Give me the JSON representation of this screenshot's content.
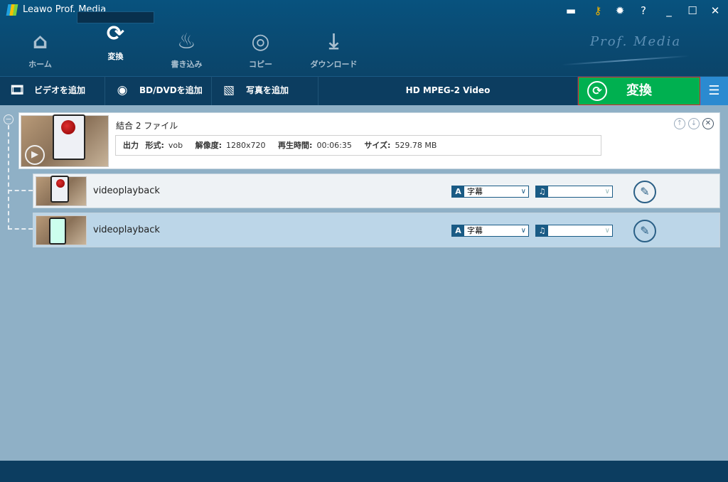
{
  "app": {
    "title": "Leawo Prof. Media",
    "watermark": "Prof. Media"
  },
  "nav": [
    {
      "label": "ホーム",
      "icon": "home-icon"
    },
    {
      "label": "変換",
      "icon": "convert-icon"
    },
    {
      "label": "書き込み",
      "icon": "burn-icon"
    },
    {
      "label": "コピー",
      "icon": "copy-icon"
    },
    {
      "label": "ダウンロード",
      "icon": "download-icon"
    }
  ],
  "toolbar": {
    "add_video": "ビデオを追加",
    "add_disc": "BD/DVDを追加",
    "add_photo": "写真を追加",
    "profile": "HD MPEG-2 Video",
    "convert": "変換"
  },
  "merged": {
    "title": "結合 2 ファイル",
    "output_label": "出力",
    "format_label": "形式:",
    "format": "vob",
    "resolution_label": "解像度:",
    "resolution": "1280x720",
    "duration_label": "再生時間:",
    "duration": "00:06:35",
    "size_label": "サイズ:",
    "size": "529.78 MB"
  },
  "files": [
    {
      "name": "videoplayback",
      "subtitle": "字幕",
      "audio": ""
    },
    {
      "name": "videoplayback",
      "subtitle": "字幕",
      "audio": ""
    }
  ],
  "colors": {
    "accent": "#00b050",
    "header": "#0b4469",
    "selected_row": "#bcd6e8"
  }
}
